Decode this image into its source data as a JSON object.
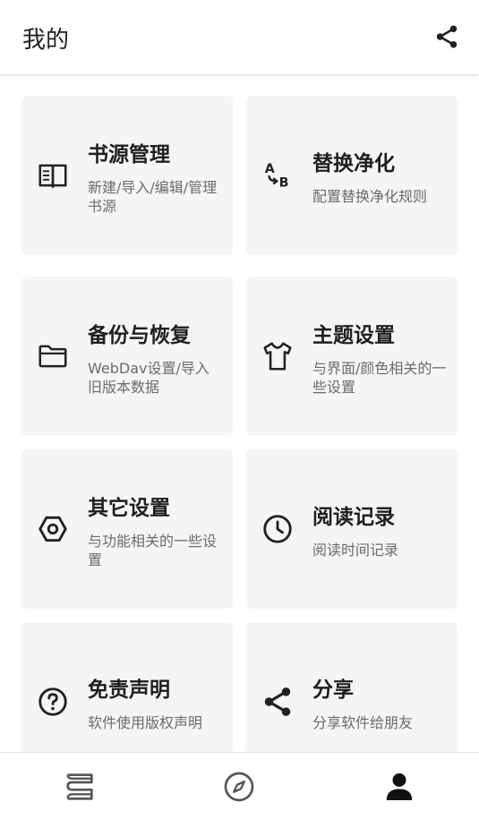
{
  "header": {
    "title": "我的",
    "share_icon": "share-icon"
  },
  "cards": [
    {
      "title": "书源管理",
      "subtitle": "新建/导入/编辑/管理书源",
      "icon": "book-icon"
    },
    {
      "title": "替换净化",
      "subtitle": "配置替换净化规则",
      "icon": "replace-icon"
    },
    {
      "title": "备份与恢复",
      "subtitle": "WebDav设置/导入旧版本数据",
      "icon": "folder-icon"
    },
    {
      "title": "主题设置",
      "subtitle": "与界面/颜色相关的一些设置",
      "icon": "shirt-icon"
    },
    {
      "title": "其它设置",
      "subtitle": "与功能相关的一些设置",
      "icon": "nut-icon"
    },
    {
      "title": "阅读记录",
      "subtitle": "阅读时间记录",
      "icon": "clock-icon"
    },
    {
      "title": "免责声明",
      "subtitle": "软件使用版权声明",
      "icon": "help-icon"
    },
    {
      "title": "分享",
      "subtitle": "分享软件给朋友",
      "icon": "share-icon"
    }
  ],
  "bottom_nav": {
    "items": [
      "bookshelf-icon",
      "explore-icon",
      "person-icon"
    ],
    "active": "person-icon"
  },
  "colors": {
    "card_bg": "#f5f5f5",
    "text": "#1f1f1f",
    "subtext": "#6b6b6b",
    "nav_inactive": "#555555",
    "nav_active": "#111111"
  }
}
